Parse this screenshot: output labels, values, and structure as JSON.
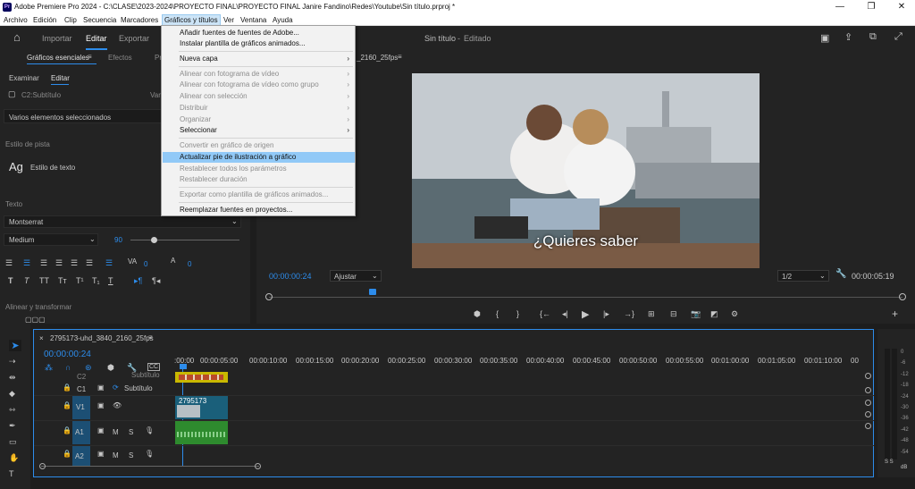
{
  "window": {
    "title": "Adobe Premiere Pro 2024 - C:\\CLASE\\2023-2024\\PROYECTO FINAL\\PROYECTO FINAL Janire Fandino\\Redes\\Youtube\\Sin título.prproj *",
    "app_icon": "Pr"
  },
  "menu": [
    "Archivo",
    "Edición",
    "Clip",
    "Secuencia",
    "Marcadores",
    "Gráficos y títulos",
    "Ver",
    "Ventana",
    "Ayuda"
  ],
  "topbar": {
    "tabs": [
      "Importar",
      "Editar",
      "Exportar"
    ],
    "project": "Sin título",
    "sep": "-",
    "status": "Editado"
  },
  "left": {
    "tabs": [
      "Gráficos esenciales",
      "Efectos",
      "Pr"
    ],
    "subtabs": [
      "Examinar",
      "Editar"
    ],
    "layer": "C2:Subtítulo",
    "multi": "Varios elementos seleccionados",
    "track_style_label": "Estilo de pista",
    "text_style": "Estilo de texto",
    "text_label": "Texto",
    "font": "Montserrat",
    "weight": "Medium",
    "size": "90",
    "tracking": "0",
    "kerning": "0",
    "align_label": "Alinear y transformar",
    "cut_label": "Var",
    "style_ag": "Ag"
  },
  "dropdown": {
    "items": [
      {
        "label": "Añadir fuentes de fuentes de Adobe...",
        "disabled": false
      },
      {
        "label": "Instalar plantilla de gráficos animados...",
        "disabled": false
      },
      {
        "label": "Nueva capa",
        "disabled": false,
        "arrow": true
      },
      {
        "label": "Alinear con fotograma de vídeo",
        "disabled": true,
        "arrow": true
      },
      {
        "label": "Alinear con fotograma de vídeo como grupo",
        "disabled": true,
        "arrow": true
      },
      {
        "label": "Alinear con selección",
        "disabled": true,
        "arrow": true
      },
      {
        "label": "Distribuir",
        "disabled": true,
        "arrow": true
      },
      {
        "label": "Organizar",
        "disabled": true,
        "arrow": true
      },
      {
        "label": "Seleccionar",
        "disabled": false,
        "arrow": true
      },
      {
        "label": "Convertir en gráfico de origen",
        "disabled": true
      },
      {
        "label": "Actualizar pie de ilustración a gráfico",
        "disabled": false,
        "highlighted": true
      },
      {
        "label": "Restablecer todos los parámetros",
        "disabled": true
      },
      {
        "label": "Restablecer duración",
        "disabled": true
      },
      {
        "label": "Exportar como plantilla de gráficos animados...",
        "disabled": true
      },
      {
        "label": "Reemplazar fuentes en proyectos...",
        "disabled": false
      }
    ],
    "arrow_glyph": "›"
  },
  "program": {
    "sequence_tab": "_2160_25fps",
    "caption": "¿Quieres saber",
    "timecode": "00:00:00:24",
    "fit": "Ajustar",
    "quality": "1/2",
    "duration": "00:00:05:19"
  },
  "timeline": {
    "tab": "2795173-uhd_3840_2160_25fps",
    "timecode": "00:00:00:24",
    "ruler": [
      ":00:00",
      "00:00:05:00",
      "00:00:10:00",
      "00:00:15:00",
      "00:00:20:00",
      "00:00:25:00",
      "00:00:30:00",
      "00:00:35:00",
      "00:00:40:00",
      "00:00:45:00",
      "00:00:50:00",
      "00:00:55:00",
      "00:01:00:00",
      "00:01:05:00",
      "00:01:10:00",
      "00"
    ],
    "tracks": [
      {
        "id": "C2",
        "name": "Subtítulo"
      },
      {
        "id": "C1",
        "name": "Subtítulo"
      },
      {
        "id": "V1",
        "name": ""
      },
      {
        "id": "A1",
        "name": ""
      },
      {
        "id": "A2",
        "name": ""
      }
    ],
    "clip_label": "2795173",
    "m": "M",
    "s": "S"
  },
  "meter": {
    "labels": [
      "0",
      "-6",
      "-12",
      "-18",
      "-24",
      "-30",
      "-36",
      "-42",
      "-48",
      "-54"
    ],
    "bottom": "dB",
    "ss": "S S"
  },
  "colors": {
    "accent": "#2d8ceb",
    "caption_clip": "#c9b800",
    "video_clip": "#1a5f7a",
    "audio_clip": "#2e8b2e"
  }
}
